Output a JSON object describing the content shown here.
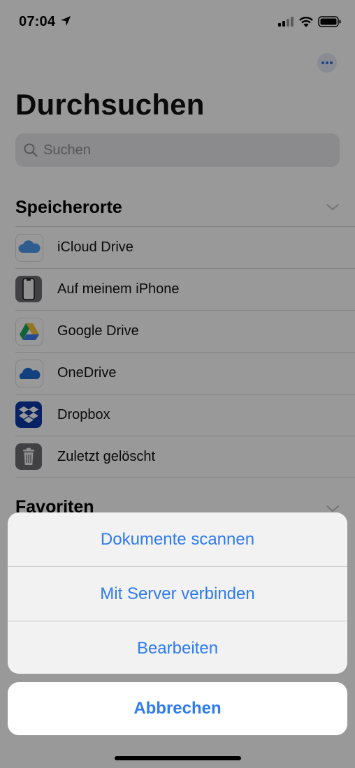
{
  "status": {
    "time": "07:04"
  },
  "header": {
    "title": "Durchsuchen"
  },
  "search": {
    "placeholder": "Suchen"
  },
  "sections": {
    "locations": {
      "title": "Speicherorte"
    },
    "favorites": {
      "title": "Favoriten"
    }
  },
  "locations": [
    {
      "label": "iCloud Drive",
      "icon": "icloud-icon"
    },
    {
      "label": "Auf meinem iPhone",
      "icon": "iphone-icon"
    },
    {
      "label": "Google Drive",
      "icon": "google-drive-icon"
    },
    {
      "label": "OneDrive",
      "icon": "onedrive-icon"
    },
    {
      "label": "Dropbox",
      "icon": "dropbox-icon"
    },
    {
      "label": "Zuletzt gelöscht",
      "icon": "trash-icon"
    }
  ],
  "action_sheet": {
    "items": [
      {
        "label": "Dokumente scannen"
      },
      {
        "label": "Mit Server verbinden"
      },
      {
        "label": "Bearbeiten"
      }
    ],
    "cancel": "Abbrechen"
  },
  "colors": {
    "accent": "#2f7bf0",
    "dim_overlay": "rgba(0,0,0,0.40)"
  }
}
